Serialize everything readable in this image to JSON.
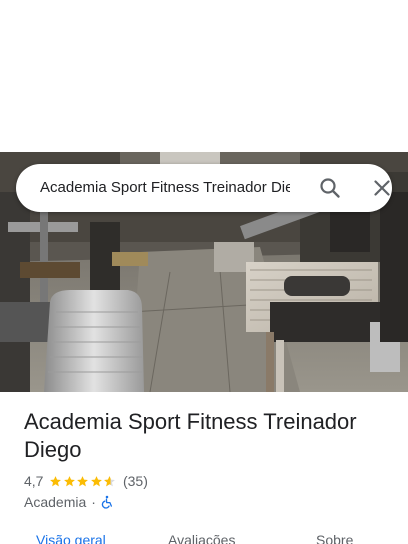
{
  "search": {
    "value": "Academia Sport Fitness Treinador Diego"
  },
  "place": {
    "name": "Academia Sport Fitness Treinador Diego",
    "rating": "4,7",
    "star_rating": 4.7,
    "review_count": "(35)",
    "category": "Academia",
    "separator": "·"
  },
  "tabs": [
    {
      "label": "Visão geral",
      "active": true
    },
    {
      "label": "Avaliações",
      "active": false
    },
    {
      "label": "Sobre",
      "active": false
    }
  ],
  "colors": {
    "accent": "#1a73e8",
    "star": "#fbbc04",
    "text_primary": "#202124",
    "text_secondary": "#5f6368"
  },
  "icons": {
    "search": "search-icon",
    "close": "close-icon",
    "accessibility": "wheelchair-icon"
  }
}
